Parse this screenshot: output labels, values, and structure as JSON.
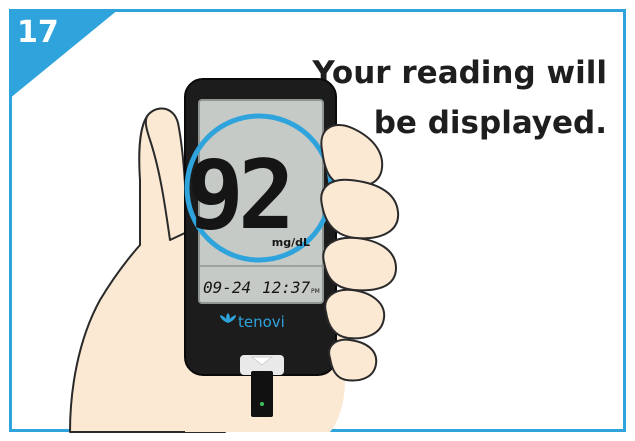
{
  "step": {
    "number": "17"
  },
  "instruction": {
    "line1": "Your reading will",
    "line2": "be displayed."
  },
  "meter": {
    "brand": "tenovi",
    "reading_value": "92",
    "reading_unit": "mg/dL",
    "date": "09-24",
    "time": "12:37",
    "time_suffix": "PM"
  },
  "colors": {
    "accent": "#2ea3dc",
    "skin": "#fbe9d4",
    "meter_body": "#1c1c1c",
    "screen": "#c5cac6"
  },
  "icons": {
    "brand_logo": "lotus-icon",
    "highlight": "highlight-circle"
  }
}
